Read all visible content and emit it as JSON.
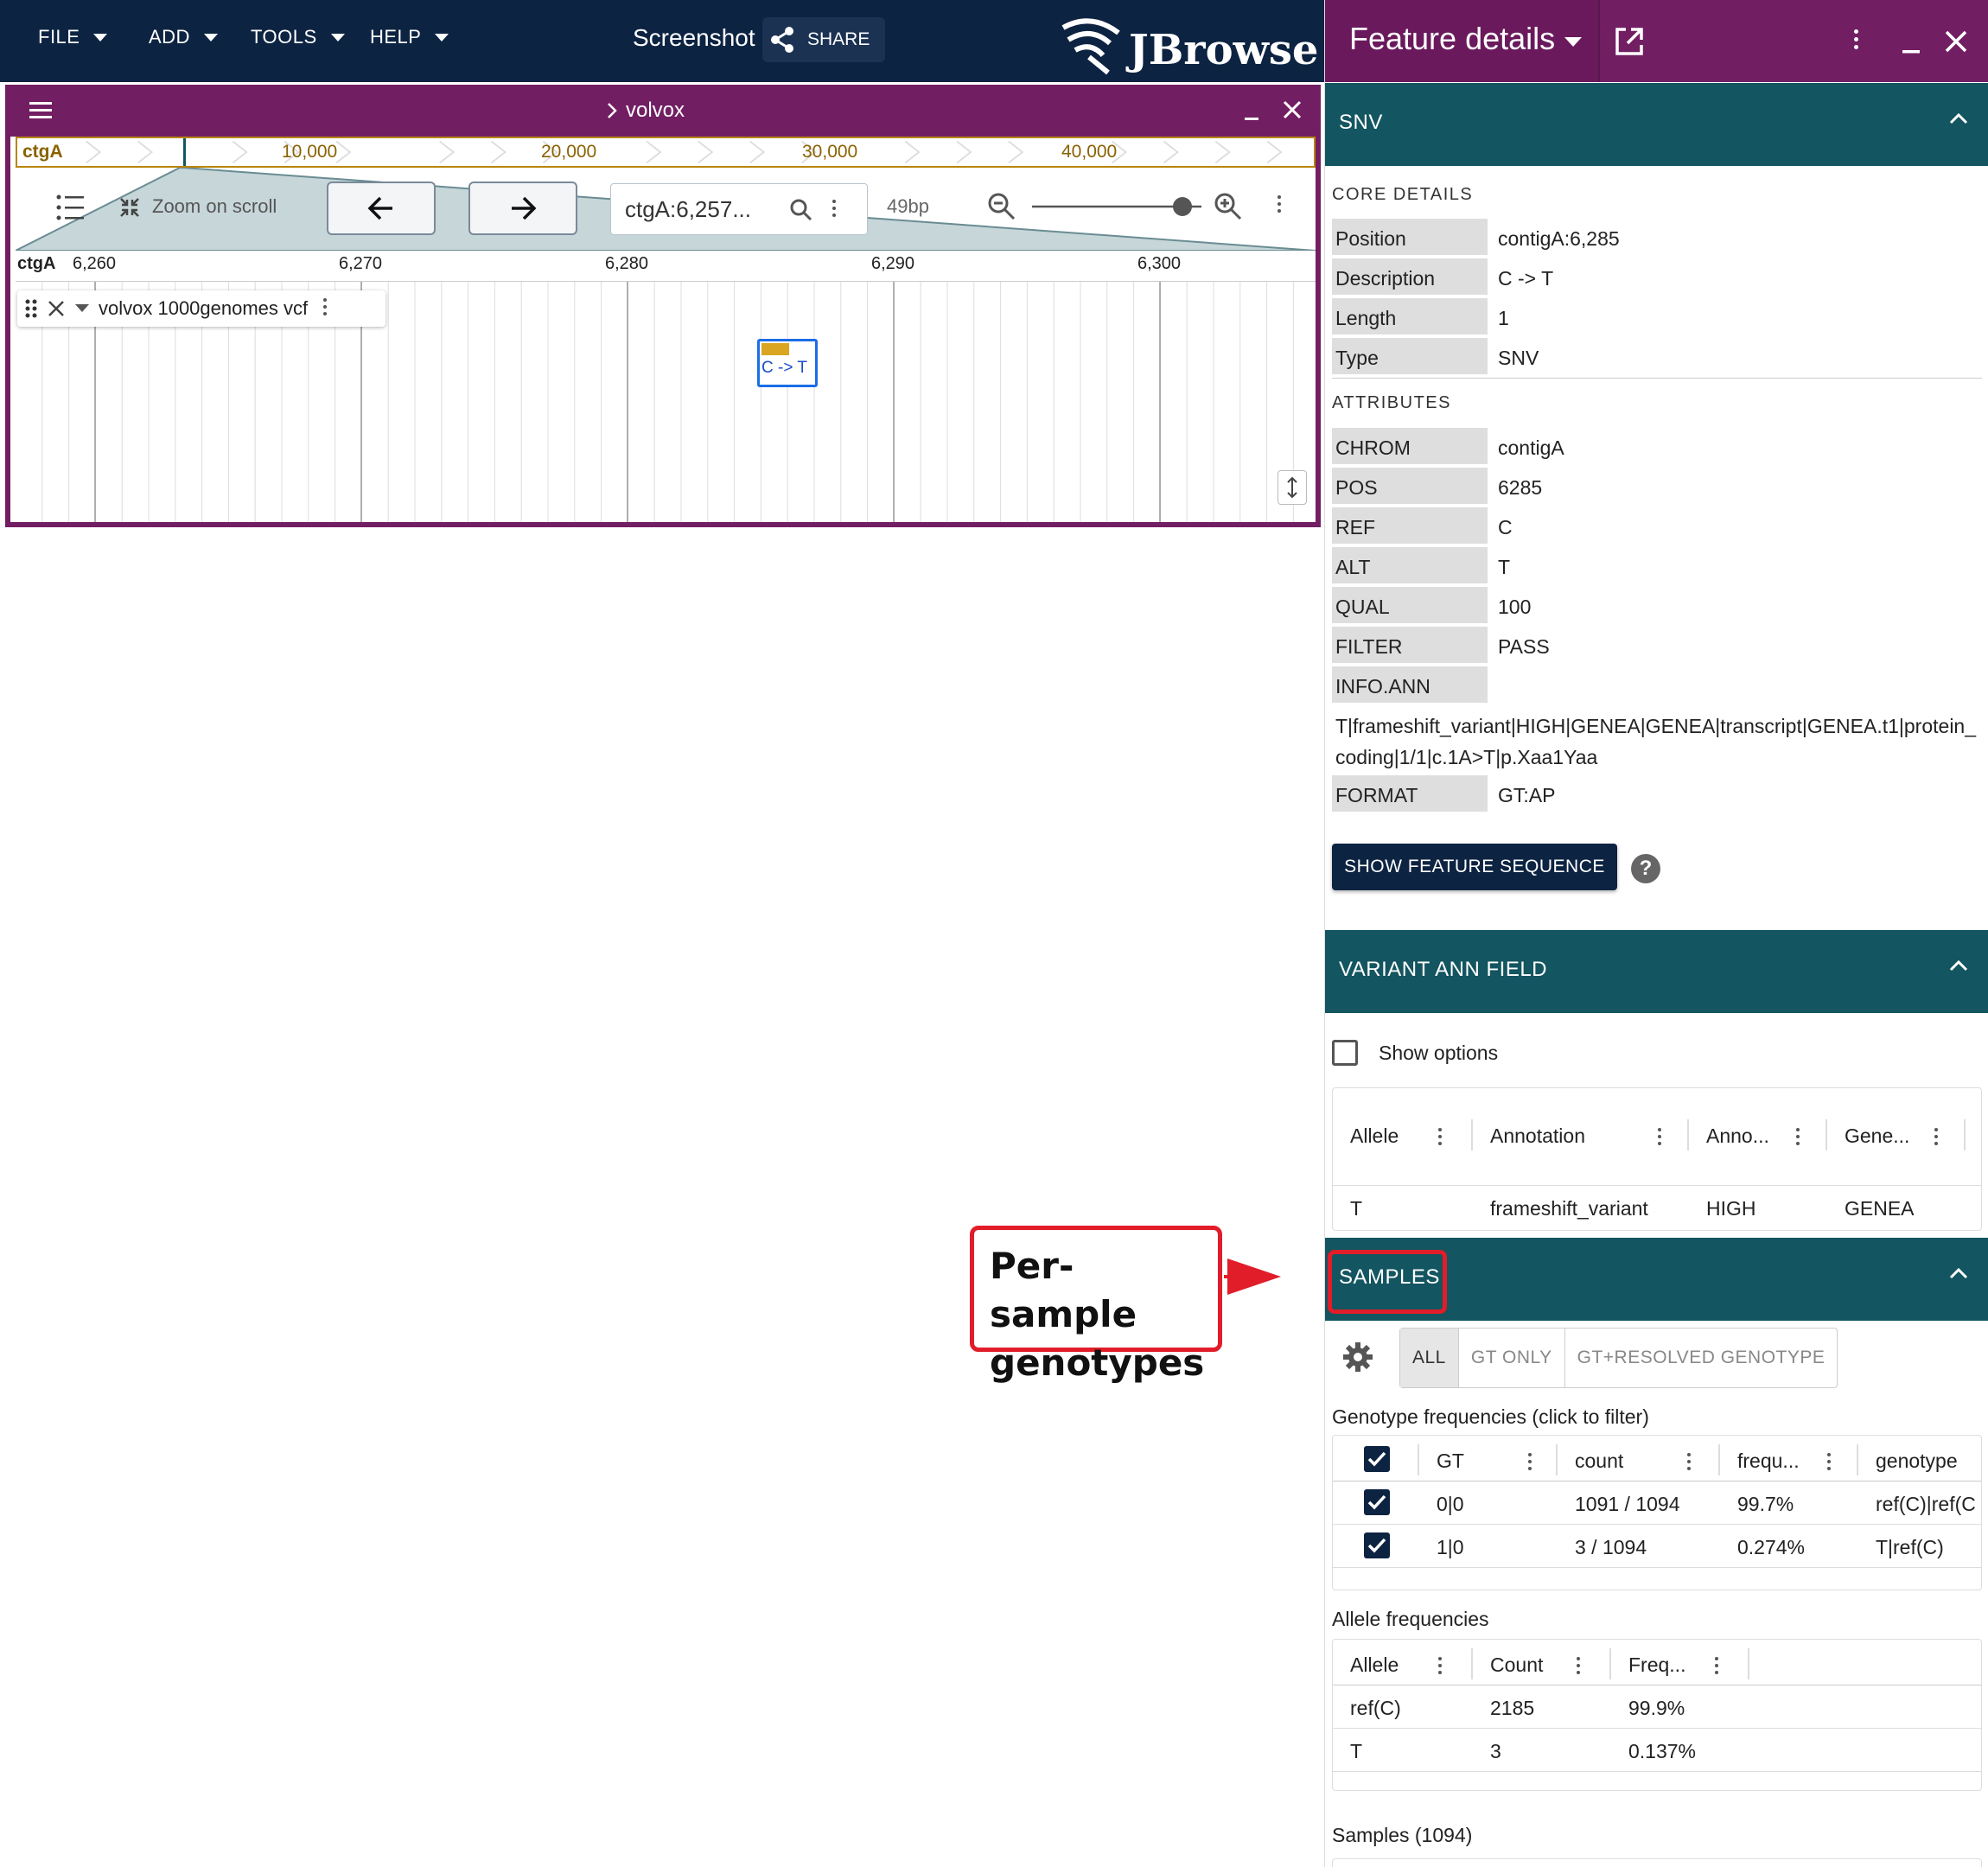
{
  "menubar": {
    "items": [
      {
        "label": "FILE"
      },
      {
        "label": "ADD"
      },
      {
        "label": "TOOLS"
      },
      {
        "label": "HELP"
      }
    ],
    "title": "Screenshot",
    "share_label": "SHARE",
    "logo_text": "JBrowse"
  },
  "view": {
    "name": "volvox",
    "overview": {
      "chrom": "ctgA",
      "ticks": [
        "10,000",
        "20,000",
        "30,000",
        "40,000"
      ]
    },
    "zoom_on_scroll": "Zoom on scroll",
    "location": "ctgA:6,257...",
    "bp_label": "49bp",
    "ruler": {
      "chrom": "ctgA",
      "ticks": [
        "6,260",
        "6,270",
        "6,280",
        "6,290",
        "6,300"
      ]
    },
    "track": {
      "name": "volvox 1000genomes vcf",
      "feature_label": "C -> T"
    }
  },
  "callout": {
    "line1": "Per-sample",
    "line2": "genotypes"
  },
  "drawer": {
    "title": "Feature details",
    "snv_section": "SNV",
    "core_details_label": "CORE DETAILS",
    "core": [
      {
        "k": "Position",
        "v": "contigA:6,285"
      },
      {
        "k": "Description",
        "v": "C -> T"
      },
      {
        "k": "Length",
        "v": "1"
      },
      {
        "k": "Type",
        "v": "SNV"
      }
    ],
    "attributes_label": "ATTRIBUTES",
    "attributes": [
      {
        "k": "CHROM",
        "v": "contigA"
      },
      {
        "k": "POS",
        "v": "6285"
      },
      {
        "k": "REF",
        "v": "C"
      },
      {
        "k": "ALT",
        "v": "T"
      },
      {
        "k": "QUAL",
        "v": "100"
      },
      {
        "k": "FILTER",
        "v": "PASS"
      },
      {
        "k": "INFO.ANN",
        "v": ""
      }
    ],
    "info_ann_value": "T|frameshift_variant|HIGH|GENEA|GENEA|transcript|GENEA.t1|protein_coding|1/1|c.1A>T|p.Xaa1Yaa",
    "format": {
      "k": "FORMAT",
      "v": "GT:AP"
    },
    "show_sequence_label": "SHOW FEATURE SEQUENCE",
    "help_glyph": "?",
    "ann_section": "VARIANT ANN FIELD",
    "show_options_label": "Show options",
    "ann_table": {
      "headers": [
        "Allele",
        "Annotation",
        "Anno...",
        "Gene..."
      ],
      "row": [
        "T",
        "frameshift_variant",
        "HIGH",
        "GENEA"
      ]
    },
    "samples_section": "SAMPLES",
    "samples_toggle": [
      "ALL",
      "GT ONLY",
      "GT+RESOLVED GENOTYPE"
    ],
    "genotype_freq_label": "Genotype frequencies (click to filter)",
    "genotype_table": {
      "headers": [
        "GT",
        "count",
        "frequ...",
        "genotype"
      ],
      "rows": [
        [
          "0|0",
          "1091 / 1094",
          "99.7%",
          "ref(C)|ref(C"
        ],
        [
          "1|0",
          "3 / 1094",
          "0.274%",
          "T|ref(C)"
        ]
      ]
    },
    "allele_freq_label": "Allele frequencies",
    "allele_table": {
      "headers": [
        "Allele",
        "Count",
        "Freq..."
      ],
      "rows": [
        [
          "ref(C)",
          "2185",
          "99.9%"
        ],
        [
          "T",
          "3",
          "0.137%"
        ]
      ]
    },
    "samples_count_label": "Samples (1094)"
  },
  "colors": {
    "appbar": "#0d2342",
    "view_header": "#721e63",
    "section_header": "#135560",
    "highlight": "#e11d2a"
  }
}
